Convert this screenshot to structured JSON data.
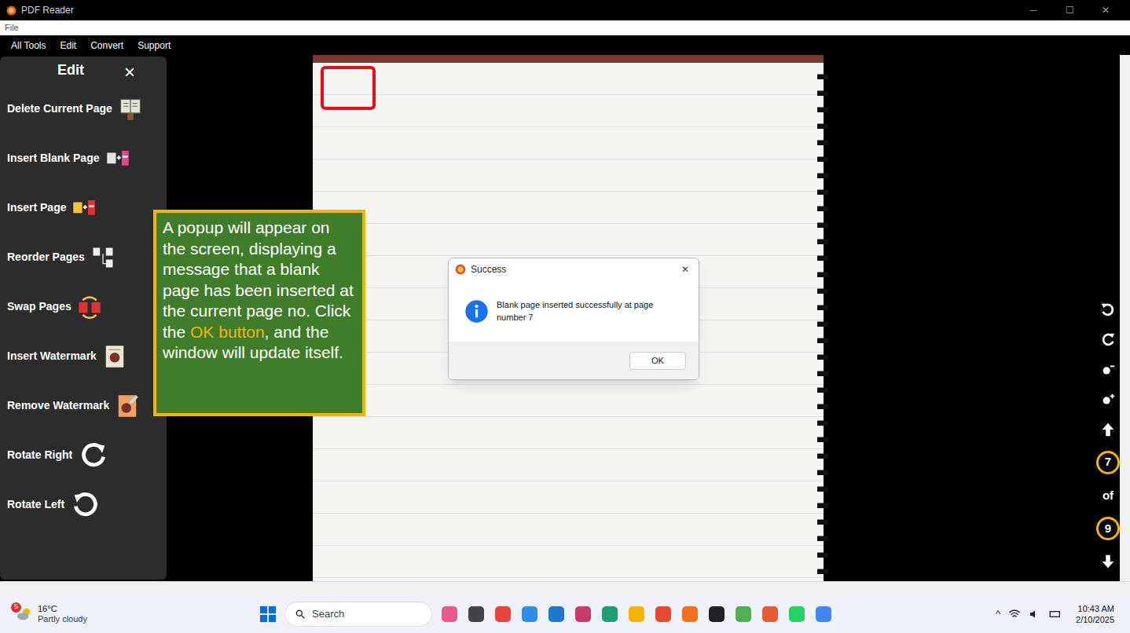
{
  "window": {
    "title": "PDF Reader",
    "controls": [
      "─",
      "☐",
      "✕"
    ]
  },
  "file_menu": [
    "File"
  ],
  "menubar": [
    "All Tools",
    "Edit",
    "Convert",
    "Support"
  ],
  "edit_panel": {
    "title": "Edit",
    "close": "×",
    "items": [
      "Delete Current Page",
      "Insert Blank Page",
      "Insert Page",
      "Reorder Pages",
      "Swap Pages",
      "Insert Watermark",
      "Remove Watermark",
      "Rotate Right",
      "Rotate Left"
    ]
  },
  "callout": {
    "before": "A popup will appear on the screen, displaying a message that a blank page has been inserted at the current page no. Click the ",
    "highlight": "OK button",
    "after": ", and the window will update itself."
  },
  "dialog": {
    "title": "Success",
    "close": "✕",
    "message": "Blank page inserted successfully at page number 7",
    "buttons": [
      "OK"
    ]
  },
  "page_nav": {
    "current": "7",
    "separator": "of",
    "total": "9"
  },
  "taskbar": {
    "weather": {
      "badge": "5",
      "temp": "16°C",
      "condition": "Partly cloudy"
    },
    "search": "Search",
    "tray_chevron": "^",
    "time": "10:43 AM",
    "date": "2/10/2025"
  }
}
